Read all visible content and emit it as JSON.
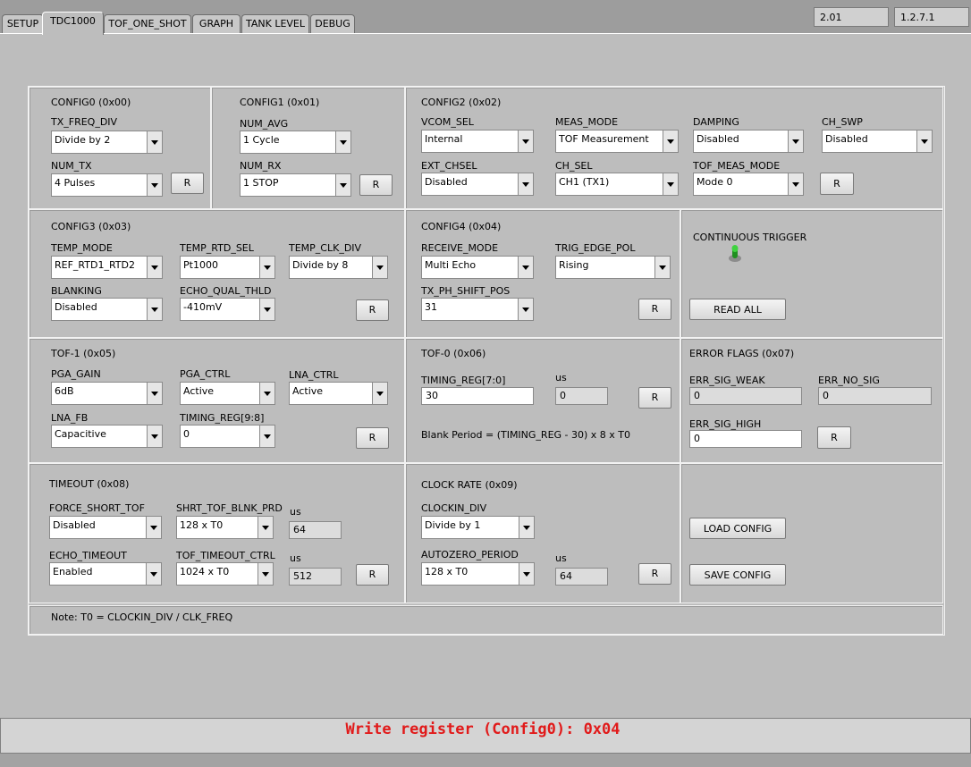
{
  "tabs": [
    "SETUP",
    "TDC1000",
    "TOF_ONE_SHOT",
    "GRAPH",
    "TANK LEVEL",
    "DEBUG"
  ],
  "versions": {
    "fw_value": "2.01",
    "gui_value": "1.2.7.1"
  },
  "config0": {
    "title": "CONFIG0 (0x00)",
    "tx_freq_div_label": "TX_FREQ_DIV",
    "tx_freq_div_value": "Divide by 2",
    "num_tx_label": "NUM_TX",
    "num_tx_value": "4 Pulses",
    "r_label": "R"
  },
  "config1": {
    "title": "CONFIG1 (0x01)",
    "num_avg_label": "NUM_AVG",
    "num_avg_value": "1 Cycle",
    "num_rx_label": "NUM_RX",
    "num_rx_value": "1 STOP",
    "r_label": "R"
  },
  "config2": {
    "title": "CONFIG2 (0x02)",
    "vcom_sel_label": "VCOM_SEL",
    "vcom_sel_value": "Internal",
    "meas_mode_label": "MEAS_MODE",
    "meas_mode_value": "TOF Measurement",
    "damping_label": "DAMPING",
    "damping_value": "Disabled",
    "ch_swp_label": "CH_SWP",
    "ch_swp_value": "Disabled",
    "ext_chsel_label": "EXT_CHSEL",
    "ext_chsel_value": "Disabled",
    "ch_sel_label": "CH_SEL",
    "ch_sel_value": "CH1 (TX1)",
    "tof_meas_mode_label": "TOF_MEAS_MODE",
    "tof_meas_mode_value": "Mode 0",
    "r_label": "R"
  },
  "config3": {
    "title": "CONFIG3 (0x03)",
    "temp_mode_label": "TEMP_MODE",
    "temp_mode_value": "REF_RTD1_RTD2",
    "temp_rtd_sel_label": "TEMP_RTD_SEL",
    "temp_rtd_sel_value": "Pt1000",
    "temp_clk_div_label": "TEMP_CLK_DIV",
    "temp_clk_div_value": "Divide by 8",
    "blanking_label": "BLANKING",
    "blanking_value": "Disabled",
    "echo_qual_thld_label": "ECHO_QUAL_THLD",
    "echo_qual_thld_value": "-410mV",
    "r_label": "R"
  },
  "config4": {
    "title": "CONFIG4 (0x04)",
    "receive_mode_label": "RECEIVE_MODE",
    "receive_mode_value": "Multi Echo",
    "trig_edge_pol_label": "TRIG_EDGE_POL",
    "trig_edge_pol_value": "Rising",
    "tx_ph_shift_pos_label": "TX_PH_SHIFT_POS",
    "tx_ph_shift_pos_value": "31",
    "r_label": "R"
  },
  "trigger": {
    "title": "CONTINUOUS TRIGGER",
    "read_all_label": "READ ALL"
  },
  "tof1": {
    "title": "TOF-1 (0x05)",
    "pga_gain_label": "PGA_GAIN",
    "pga_gain_value": "6dB",
    "pga_ctrl_label": "PGA_CTRL",
    "pga_ctrl_value": "Active",
    "lna_ctrl_label": "LNA_CTRL",
    "lna_ctrl_value": "Active",
    "lna_fb_label": "LNA_FB",
    "lna_fb_value": "Capacitive",
    "timing_reg_98_label": "TIMING_REG[9:8]",
    "timing_reg_98_value": "0",
    "r_label": "R"
  },
  "tof0": {
    "title": "TOF-0 (0x06)",
    "timing_reg_70_label": "TIMING_REG[7:0]",
    "timing_reg_70_value": "30",
    "us_label": "us",
    "us_value": "0",
    "blank_period": "Blank Period = (TIMING_REG - 30) x 8 x T0",
    "r_label": "R"
  },
  "errors": {
    "title": "ERROR FLAGS (0x07)",
    "err_sig_weak_label": "ERR_SIG_WEAK",
    "err_sig_weak_value": "0",
    "err_no_sig_label": "ERR_NO_SIG",
    "err_no_sig_value": "0",
    "err_sig_high_label": "ERR_SIG_HIGH",
    "err_sig_high_value": "0",
    "r_label": "R"
  },
  "timeout": {
    "title": "TIMEOUT (0x08)",
    "force_short_tof_label": "FORCE_SHORT_TOF",
    "force_short_tof_value": "Disabled",
    "shrt_tof_blnk_prd_label": "SHRT_TOF_BLNK_PRD",
    "shrt_tof_blnk_prd_value": "128 x T0",
    "us1_label": "us",
    "us1_value": "64",
    "echo_timeout_label": "ECHO_TIMEOUT",
    "echo_timeout_value": "Enabled",
    "tof_timeout_ctrl_label": "TOF_TIMEOUT_CTRL",
    "tof_timeout_ctrl_value": "1024 x T0",
    "us2_label": "us",
    "us2_value": "512",
    "r_label": "R"
  },
  "clock": {
    "title": "CLOCK RATE (0x09)",
    "clockin_div_label": "CLOCKIN_DIV",
    "clockin_div_value": "Divide by 1",
    "autozero_period_label": "AUTOZERO_PERIOD",
    "autozero_period_value": "128 x T0",
    "us_label": "us",
    "us_value": "64",
    "r_label": "R"
  },
  "config_actions": {
    "load_label": "LOAD CONFIG",
    "save_label": "SAVE CONFIG"
  },
  "note": "Note: T0 = CLOCKIN_DIV / CLK_FREQ",
  "status": "Write register (Config0): 0x04",
  "colors": {
    "status_text": "#e11a1a",
    "led_green": "#2fbf2f",
    "background": "#bdbdbd"
  }
}
